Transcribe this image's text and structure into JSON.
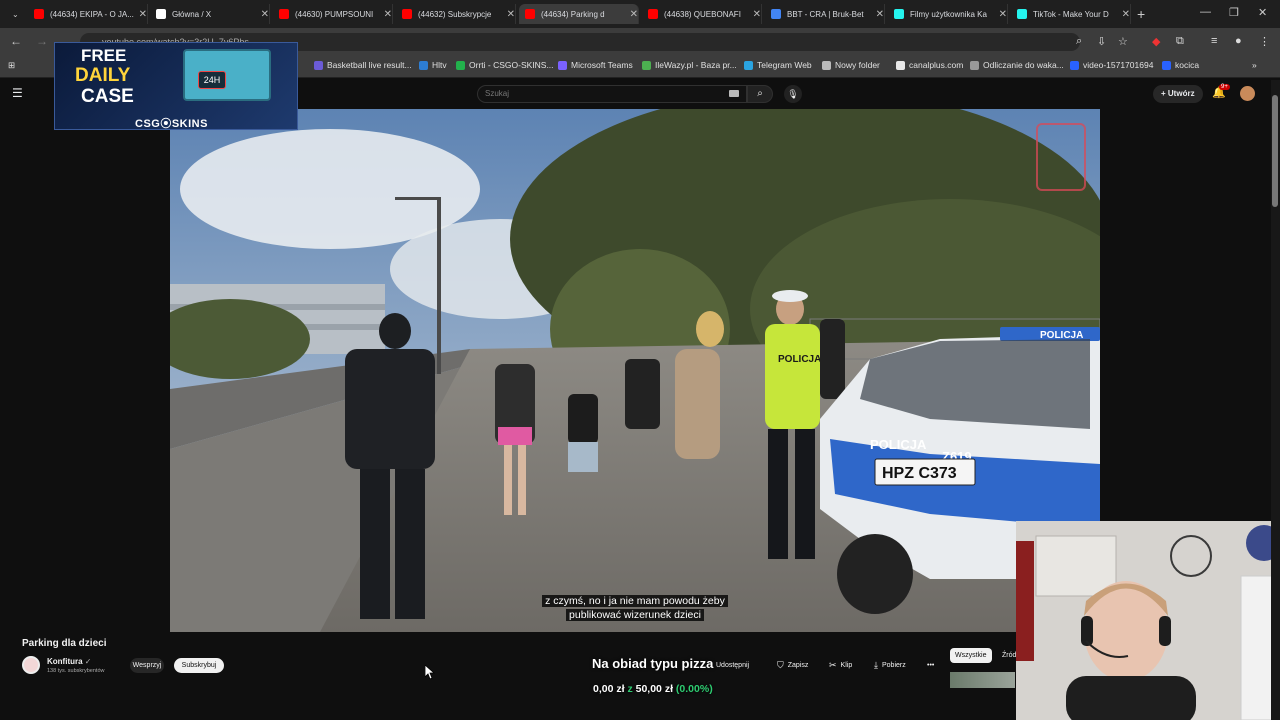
{
  "browser": {
    "tabs": [
      {
        "title": "(44634) EKIPA - O JA...",
        "favicon_color": "#ff0000",
        "active": false
      },
      {
        "title": "Główna / X",
        "favicon_color": "#ffffff",
        "active": false
      },
      {
        "title": "(44630) PUMPSOUNI",
        "favicon_color": "#ff0000",
        "active": false
      },
      {
        "title": "(44632) Subskrypcje",
        "favicon_color": "#ff0000",
        "active": false
      },
      {
        "title": "(44634) Parking d",
        "favicon_color": "#ff0000",
        "active": true
      },
      {
        "title": "(44638) QUEBONAFI",
        "favicon_color": "#ff0000",
        "active": false
      },
      {
        "title": "BBT - CRA | Bruk-Bet",
        "favicon_color": "#4285f4",
        "active": false
      },
      {
        "title": "Filmy użytkownika Ka",
        "favicon_color": "#25f4ee",
        "active": false
      },
      {
        "title": "TikTok - Make Your D",
        "favicon_color": "#25f4ee",
        "active": false
      }
    ],
    "url": "youtube.com/watch?v=3r2U_7v6Pbs",
    "bookmarks": [
      "Basketball live result...",
      "Hltv",
      "Orrti - CSGO-SKINS...",
      "Microsoft Teams",
      "IleWazy.pl - Baza pr...",
      "Telegram Web",
      "Nowy folder",
      "canalplus.com",
      "Odliczanie do waka...",
      "video-1571701694",
      "kocica"
    ]
  },
  "youtube": {
    "search_placeholder": "Szukaj",
    "create_label": "Utwórz",
    "notification_count": "9+",
    "video_title": "Parking dla dzieci",
    "channel_name": "Konfitura",
    "channel_subs": "138 tys. subskrybentów",
    "join_label": "Wesprzyj",
    "subscribe_label": "Subskrybuj",
    "actions": {
      "share": "Udostępnij",
      "save": "Zapisz",
      "clip": "Klip",
      "download": "Pobierz"
    },
    "chips": [
      "Wszystkie",
      "Źród"
    ]
  },
  "video": {
    "subtitle_line1": "z czymś, no i ja nie mam powodu żeby",
    "subtitle_line2": "publikować wizerunek dzieci",
    "plate": "HPZ C373",
    "car_text": "POLICJA",
    "car_number": "Z619",
    "roof_sign": "POLICJA",
    "vest_text": "POLICJA"
  },
  "ad": {
    "line1": "FREE",
    "line2": "DAILY",
    "line3": "CASE",
    "badge": "24H",
    "brand": "CSG⦿SKINS"
  },
  "stream_overlay": {
    "goal_title": "Na obiad typu pizza",
    "current": "0,00 zł",
    "sep": "z",
    "target": "50,00 zł",
    "percent": "(0.00%)"
  }
}
